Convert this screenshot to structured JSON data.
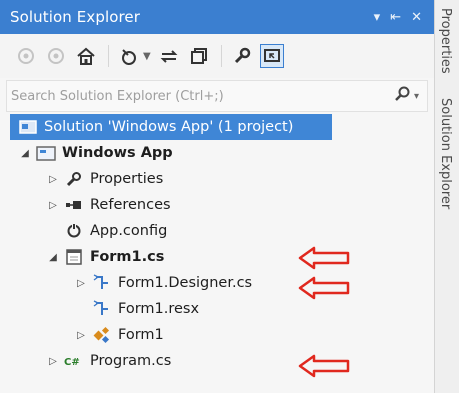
{
  "window": {
    "title": "Solution Explorer",
    "controls": [
      "▾",
      "⇤",
      "✕"
    ]
  },
  "side_tabs": [
    "Properties",
    "Solution Explorer"
  ],
  "search": {
    "placeholder": "Search Solution Explorer (Ctrl+;)",
    "value": ""
  },
  "tree": {
    "solution": "Solution 'Windows App' (1 project)",
    "project": "Windows App",
    "properties": "Properties",
    "references": "References",
    "app_config": "App.config",
    "form1_cs": "Form1.cs",
    "form1_designer": "Form1.Designer.cs",
    "form1_resx": "Form1.resx",
    "form1_class": "Form1",
    "program_cs": "Program.cs"
  },
  "colors": {
    "titlebar": "#3b7fd0",
    "selection": "#3f86d6",
    "annotation_arrow": "#e0281e"
  }
}
